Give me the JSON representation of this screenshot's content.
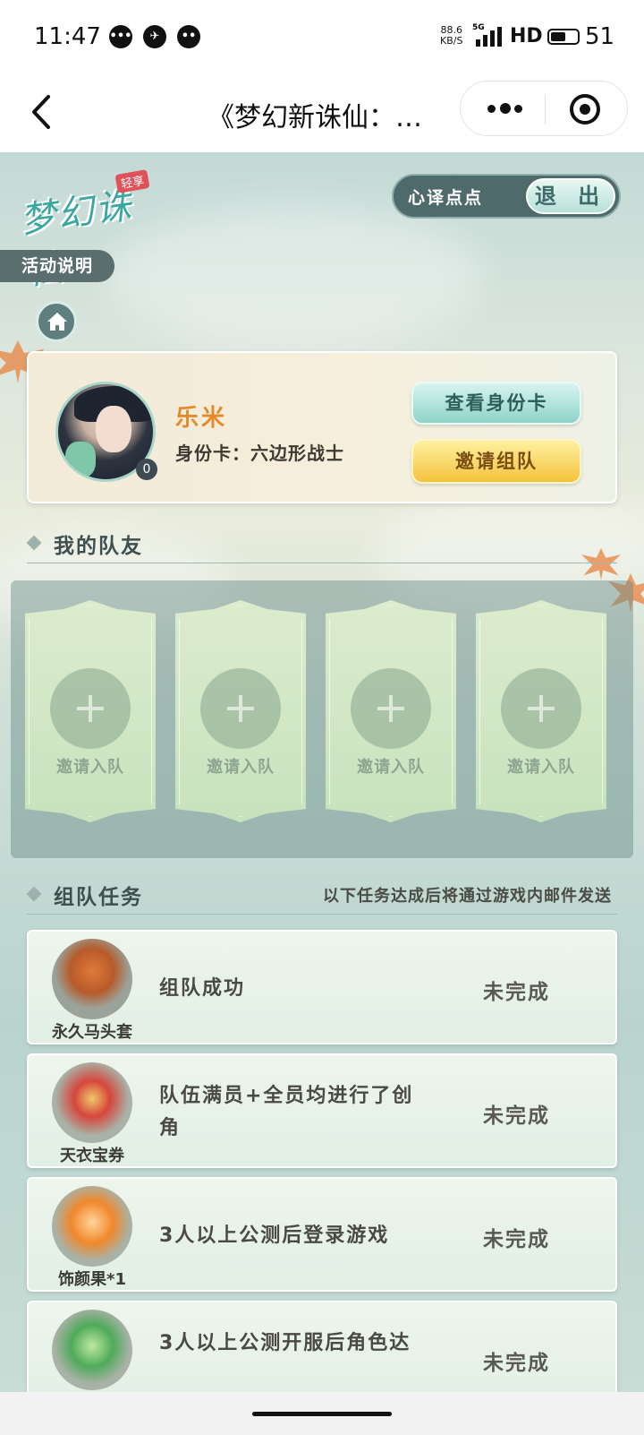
{
  "status_bar": {
    "time": "11:47",
    "net_speed_value": "88.6",
    "net_speed_unit": "KB/S",
    "network_type": "5G",
    "hd": "HD",
    "battery": "51",
    "app_icons": [
      "chat-bubble-icon",
      "feather-icon",
      "chat-bubble-icon"
    ]
  },
  "nav": {
    "title": "《梦幻新诛仙：…"
  },
  "header": {
    "logo_tag": "轻享",
    "logo_text": "梦幻诛仙",
    "user_name": "心译点点",
    "exit_label": "退 出",
    "rules_label": "活动说明"
  },
  "profile": {
    "name": "乐米",
    "identity_card": "身份卡：六边形战士",
    "avatar_count": "0",
    "view_card_label": "查看身份卡",
    "invite_team_label": "邀请组队"
  },
  "teammates": {
    "title": "我的队友",
    "slots": [
      {
        "label": "邀请入队"
      },
      {
        "label": "邀请入队"
      },
      {
        "label": "邀请入队"
      },
      {
        "label": "邀请入队"
      }
    ]
  },
  "tasks": {
    "title": "组队任务",
    "note": "以下任务达成后将通过游戏内邮件发送",
    "items": [
      {
        "reward": "永久马头套",
        "text": "组队成功",
        "status": "未完成",
        "icon": "horse-head-icon"
      },
      {
        "reward": "天衣宝券",
        "text": "队伍满员+全员均进行了创角",
        "status": "未完成",
        "icon": "coupon-icon"
      },
      {
        "reward": "饰颜果*1",
        "text": "3人以上公测后登录游戏",
        "status": "未完成",
        "icon": "fruit-orb-icon"
      },
      {
        "reward": "",
        "text": "3人以上公测开服后角色达",
        "status": "未完成",
        "icon": "jade-ring-icon"
      }
    ]
  },
  "colors": {
    "accent_orange": "#e38a2c",
    "teal_button": "#8fd3c9",
    "gold_button": "#f4c33c"
  }
}
